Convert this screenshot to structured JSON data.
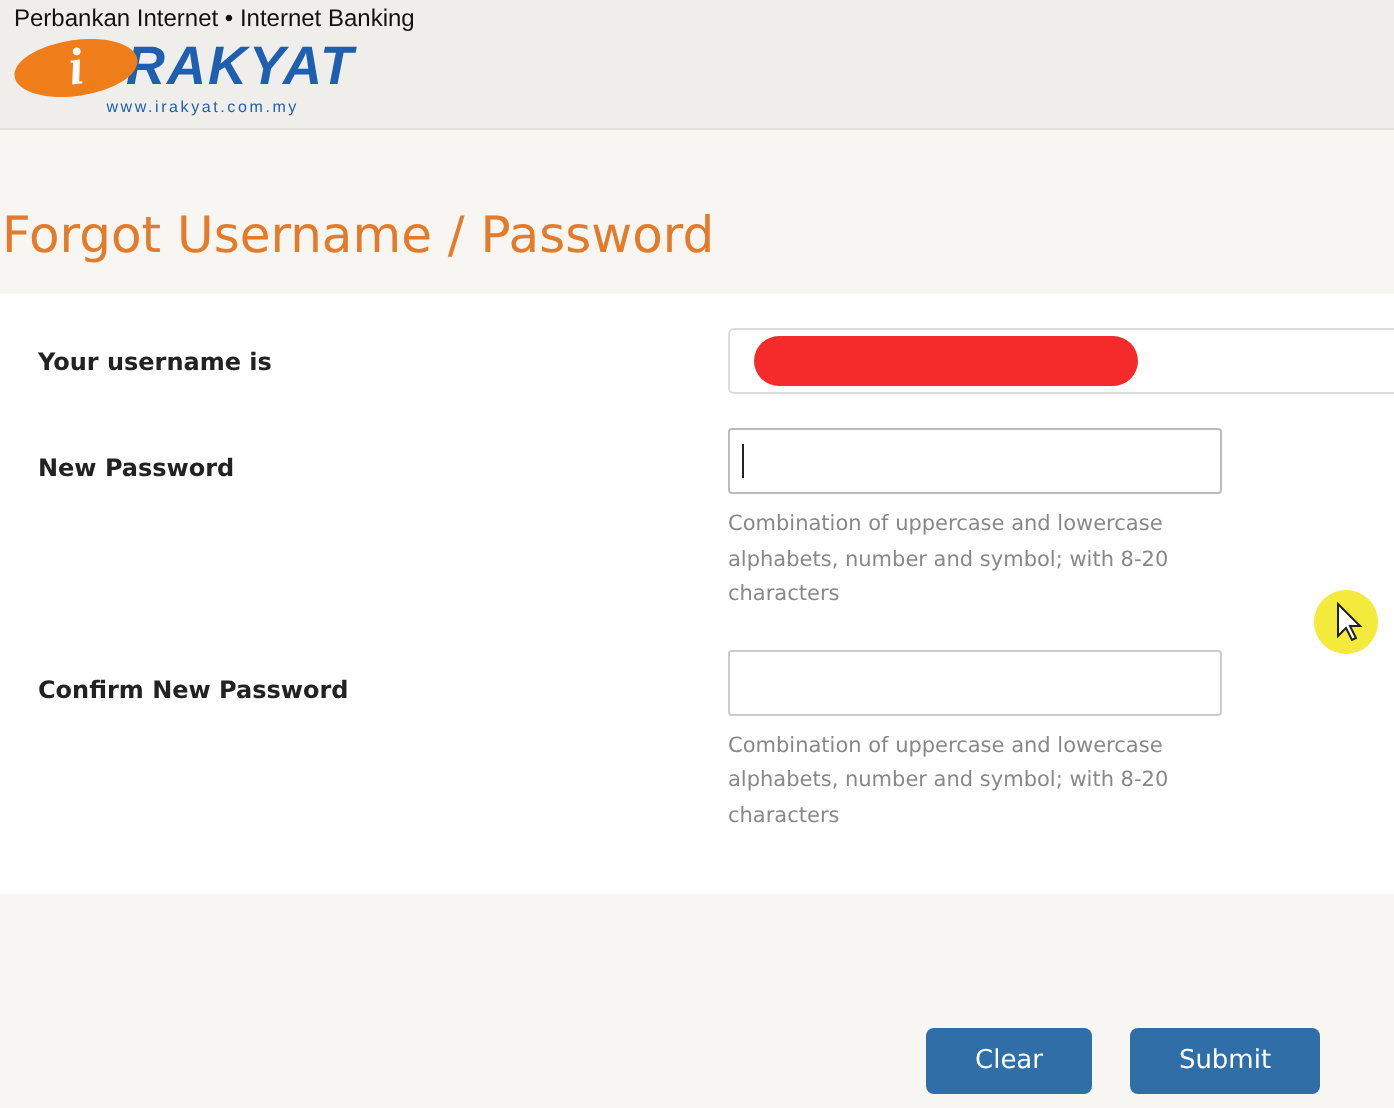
{
  "header": {
    "tagline": "Perbankan Internet • Internet Banking",
    "logo_letter": "i",
    "logo_name": "RAKYAT",
    "logo_url": "www.irakyat.com.my"
  },
  "title": "Forgot Username / Password",
  "fields": [
    {
      "kind": "readonly",
      "label": "Your username is",
      "redacted": true
    },
    {
      "kind": "password",
      "label": "New Password",
      "focused": true,
      "hint": "Combination of uppercase and lowercase alphabets, number and symbol; with 8-20 characters"
    },
    {
      "kind": "password",
      "label": "Confirm New Password",
      "focused": false,
      "hint": "Combination of uppercase and lowercase alphabets, number and symbol; with 8-20 characters"
    }
  ],
  "buttons": [
    "Clear",
    "Submit"
  ]
}
